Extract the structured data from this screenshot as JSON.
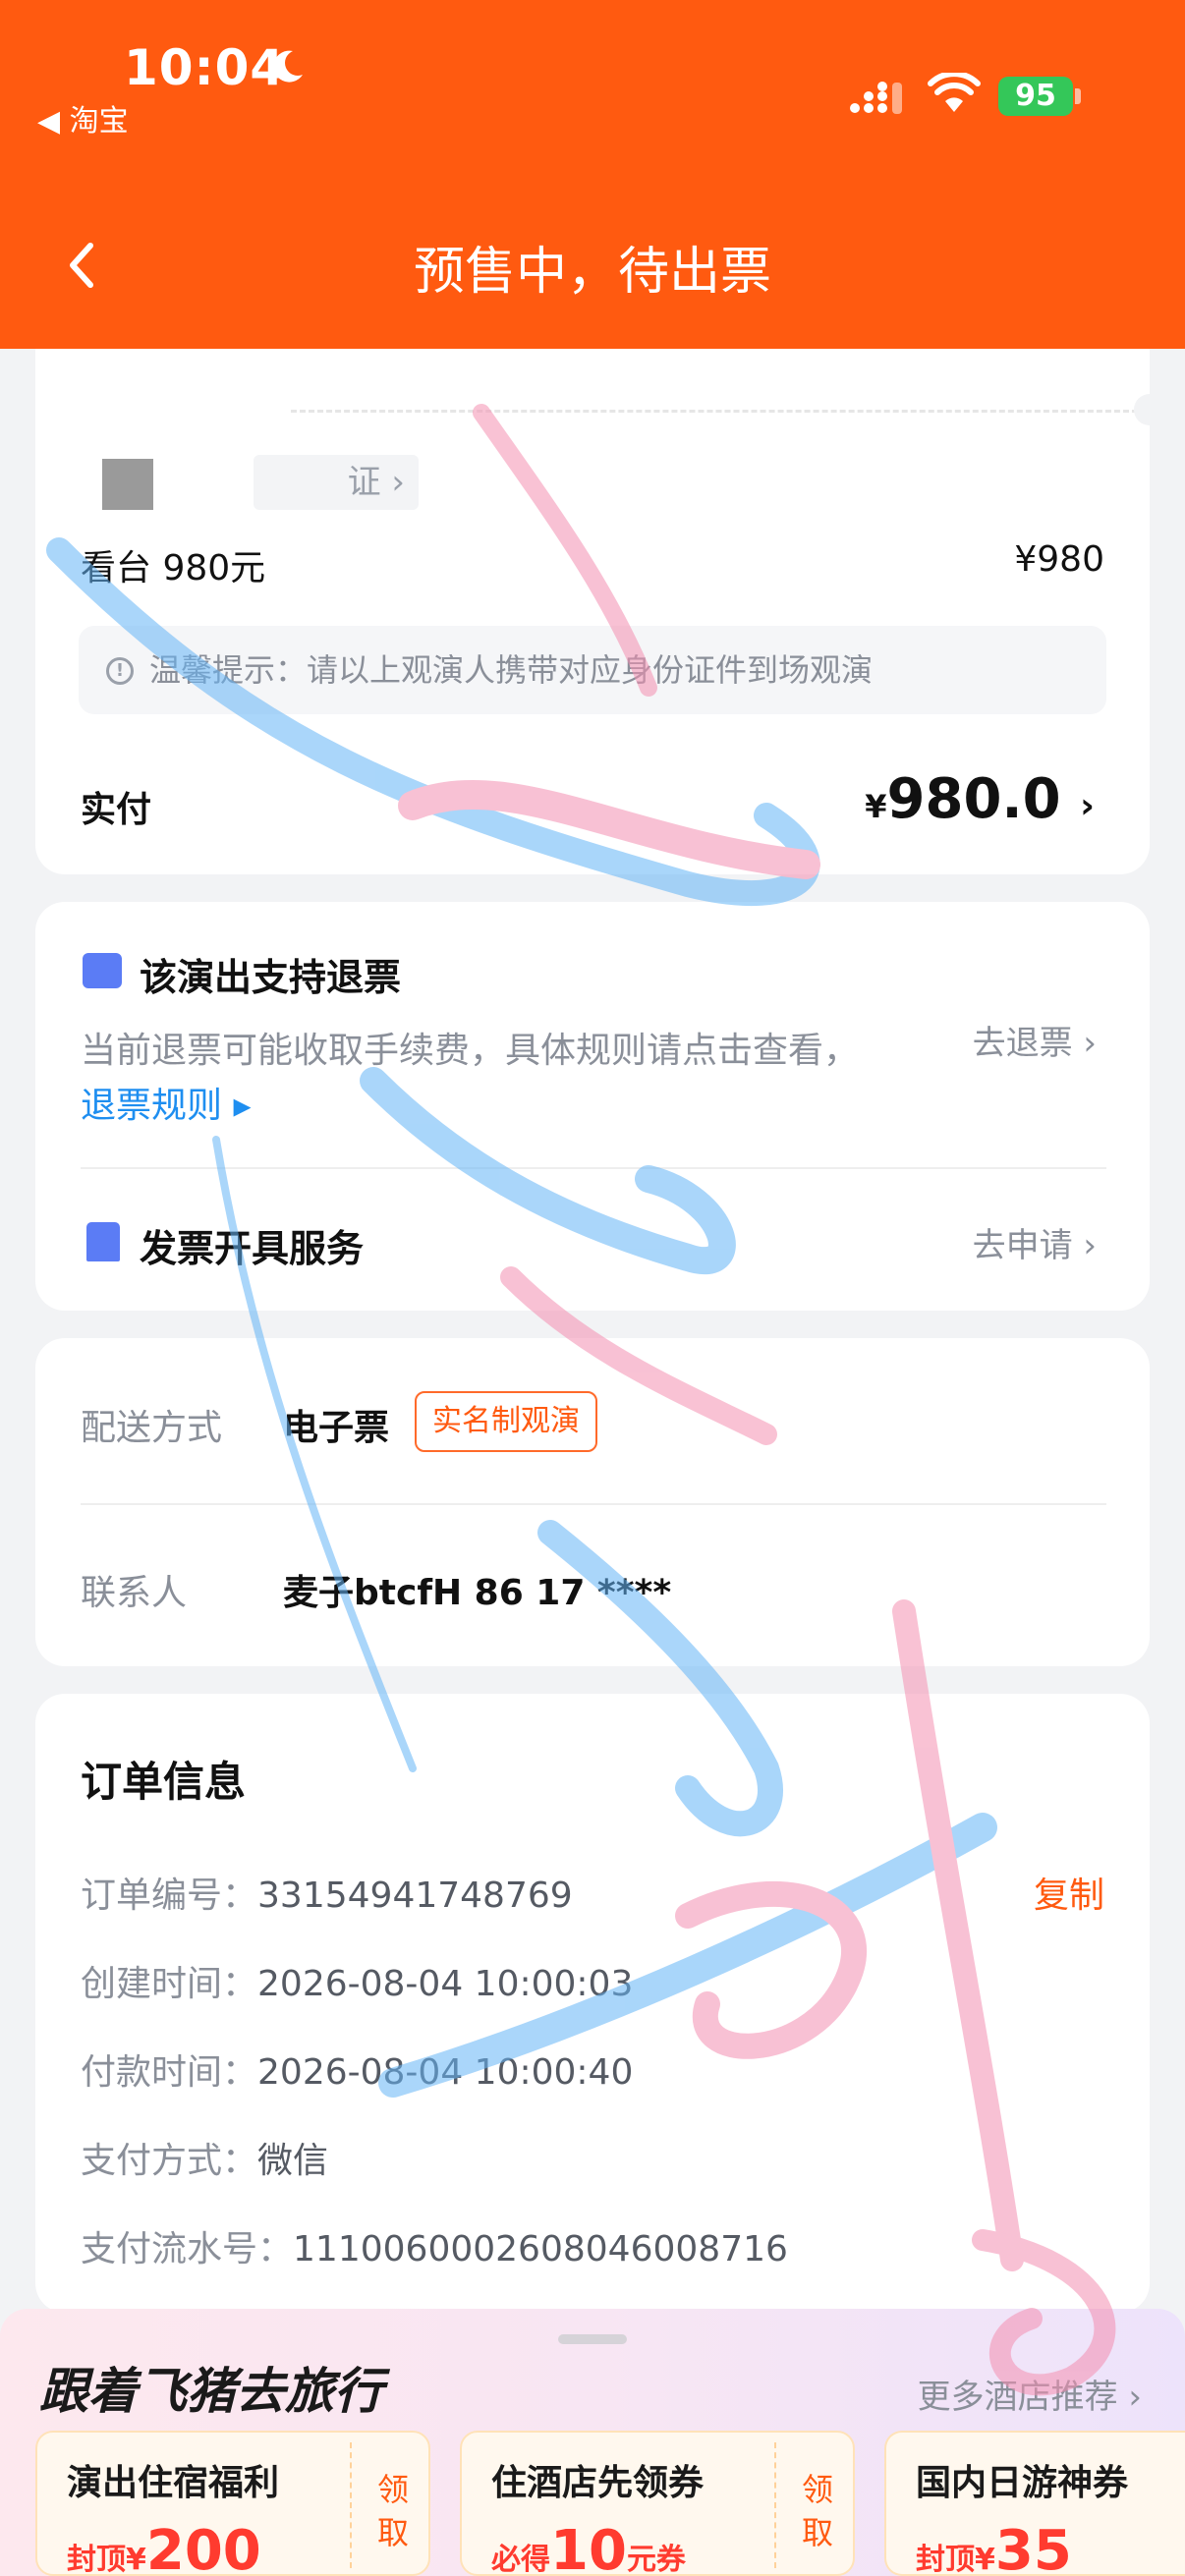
{
  "status_bar": {
    "time": "10:04",
    "back_app": "◀ 淘宝",
    "battery": "95"
  },
  "nav": {
    "title": "预售中，待出票"
  },
  "ticket": {
    "cert_label": "证 ›",
    "name": "看台 980元",
    "price": "¥980",
    "tip": "温馨提示：请以上观演人携带对应身份证件到场观演",
    "paid_label": "实付",
    "paid_currency": "¥",
    "paid_amount": "980.0"
  },
  "refund": {
    "title": "该演出支持退票",
    "desc": "当前退票可能收取手续费，具体规则请点击查看，",
    "rule_link": "退票规则 ▸",
    "action": "去退票 ›"
  },
  "invoice": {
    "title": "发票开具服务",
    "action": "去申请 ›"
  },
  "delivery": {
    "label": "配送方式",
    "value": "电子票",
    "badge": "实名制观演",
    "contact_label": "联系人",
    "contact_value": "麦子btcfH  86 17 ****"
  },
  "order": {
    "title": "订单信息",
    "copy": "复制",
    "lines": [
      {
        "label": "订单编号：",
        "value": "33154941748769"
      },
      {
        "label": "创建时间：",
        "value": "2026-08-04 10:00:03"
      },
      {
        "label": "付款时间：",
        "value": "2026-08-04 10:00:40"
      },
      {
        "label": "支付方式：",
        "value": "微信"
      },
      {
        "label": "支付流水号：",
        "value": "11100600026080460087​16"
      }
    ]
  },
  "promo": {
    "title": "跟着飞猪去旅行",
    "more": "更多酒店推荐 ›",
    "coupons": [
      {
        "name": "演出住宿福利",
        "prefix": "封顶¥",
        "amount": "200",
        "suffix": "",
        "get": "领取"
      },
      {
        "name": "住酒店先领券",
        "prefix": "必得",
        "amount": "10",
        "suffix": "元券",
        "get": "领取"
      },
      {
        "name": "国内日游神券",
        "prefix": "封顶¥",
        "amount": "35",
        "suffix": "",
        "get": ""
      }
    ]
  },
  "colors": {
    "brand": "#ff5a10",
    "link": "#1e8ef0",
    "accent_icon": "#5b7cf5"
  }
}
